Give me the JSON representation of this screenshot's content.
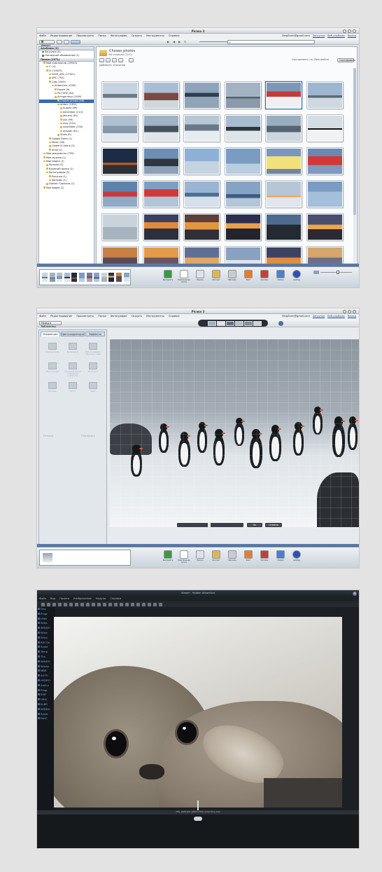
{
  "screen1": {
    "window_title": "Picasa 3",
    "menu": [
      "Файл",
      "Редактирование",
      "Просмотреть",
      "Папка",
      "Фотографии",
      "Создать",
      "Инструменты",
      "Справка"
    ],
    "account_email": "OlegZorin@gmail.com",
    "account_links": [
      "Загрузки",
      "Веб-альбомы",
      "Выход"
    ],
    "import_button": "Импорт",
    "sidebar_sections": [
      {
        "label": "Альбомы (2)",
        "items": [
          "Загрузка (0)",
          "Последние обновления (1)"
        ]
      },
      {
        "label": "Папки (1371)",
        "items": [
          "Мой компьютер (29943)",
          "C: (4)",
          "D: (10025)",
          "DCIM_ARC (17341)",
          "ARC (754)",
          "Сам (1505)",
          "Antarctica (1509)",
          "Export (9)",
          "PICTURE (84)",
          "Антарктика (1459)",
          "Chosen photos (66)",
          "Antarc (1381)",
          "August (89)",
          "december (213)",
          "january (61)",
          "July (99)",
          "may (214)",
          "november (230)",
          "october (61)",
          "Shots (0)",
          "Google Earth (1)",
          "Music (28)",
          "Quake III Arena (3)",
          "Snap (2)",
          "Мои документы (759)",
          "Моя музыка (1)",
          "Мои видео (1)",
          "Музыка (5)",
          "Кошачий ролик (1)",
          "Фотографии (5)",
          "Рисунки (1)",
          "Фильмы (1)",
          "Domain Captures (1)",
          "Моя видео (1)"
        ]
      }
    ],
    "selected_folder": "Chosen photos",
    "selected_count": "66",
    "folder_title": "Chosen photos",
    "folder_subtitle": "66 snapshots (2012)",
    "folder_description": "Добавить описание",
    "toolbar_right": [
      "Сортировать по: Имя файла",
      "Сортировать"
    ],
    "slider_label": "Масштаб"
  },
  "screen2": {
    "window_title": "Picasa 3",
    "menu": [
      "Файл",
      "Редактирование",
      "Просмотреть",
      "Папка",
      "Фотографии",
      "Создать",
      "Инструменты",
      "Справка"
    ],
    "account_email": "OlegZorin@gmail.com",
    "account_links": [
      "Загрузки",
      "Веб-альбомы",
      "Выход"
    ],
    "back_button": "Назад в библиотеку",
    "tabs": [
      "Коррекция",
      "Цветокоррекция",
      "Эффекты"
    ],
    "panel_buttons": [
      "Кадрировать",
      "Выпрямить",
      "Убрать эффект \"красных глаз\"",
      "Мне повезёт",
      "Автоматическая коррекция контраста",
      "Авто цвет",
      "Ретушь",
      "Текст",
      "Свет"
    ],
    "panel_footer": [
      "Отмена",
      "Повторить"
    ],
    "apply_button": "Ок",
    "cancel_button": "Отмена"
  },
  "screen3": {
    "window_title": "Viewer - Hidden Antarctica",
    "menu": [
      "Файл",
      "Вид",
      "Правка",
      "Изображение",
      "Модули",
      "Справка",
      "Файл",
      "Окна"
    ],
    "status_text": "IMG_6932.JPG  3888×2592  Antarctica seal",
    "tree_items": [
      "Disc",
      "Progr",
      "HYBI",
      "Reda",
      "WINDO",
      "Wind",
      "Wind",
      "RECOV",
      "Syste",
      "Temp",
      "Thu",
      "WINDO",
      "Windo",
      "MBR",
      "AUTO",
      "HYDRO",
      "AmiLa",
      "Progr",
      "SHIF",
      "Utilit",
      "KLBR",
      "WINDO",
      "Syste",
      "DirrC"
    ]
  },
  "tray_tools": [
    "Выгрузить",
    "Электронная почта",
    "Печать",
    "Экспорт",
    "Магазин",
    "Блог",
    "Коллаж",
    "Фильм",
    "Geotag"
  ],
  "colors": {
    "accent": "#2f63b3",
    "selection": "#3d6aa8",
    "statusbar": "#4c6c99"
  }
}
